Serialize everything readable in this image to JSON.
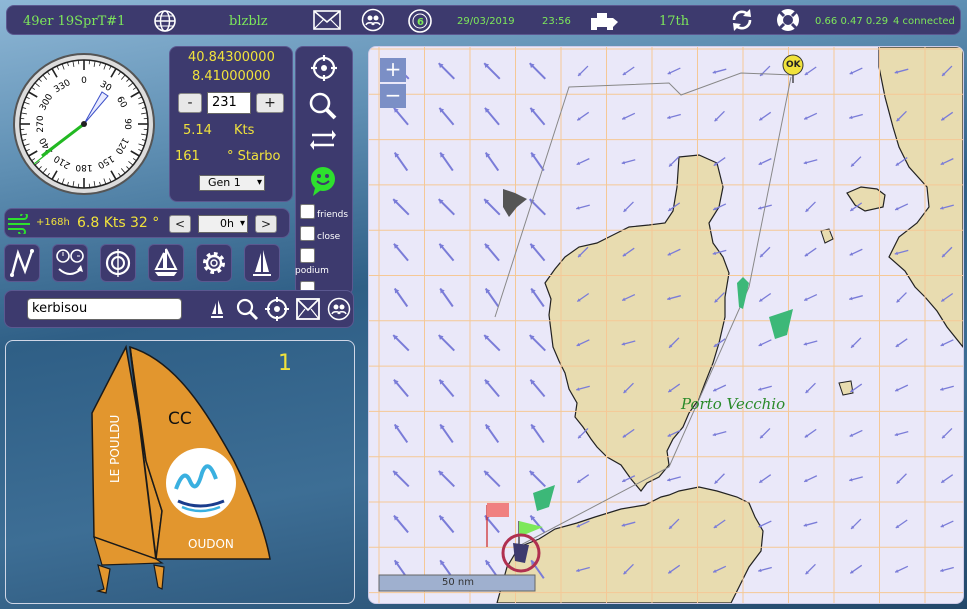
{
  "topbar": {
    "race_name": "49er 19SprT#1",
    "player_name": "blzblz",
    "notification_count": "6",
    "date": "29/03/2019",
    "time": "23:56",
    "rank": "17th",
    "load": "0.66 0.47 0.29",
    "connected": "4 connected"
  },
  "compass": {
    "ticks": [
      "0",
      "30",
      "60",
      "90",
      "120",
      "150",
      "180",
      "210",
      "240",
      "270",
      "300",
      "330"
    ]
  },
  "nav": {
    "latitude": "40.84300000",
    "longitude": "8.41000000",
    "minus_label": "-",
    "plus_label": "+",
    "heading_value": "231",
    "speed": "5.14",
    "speed_unit": "Kts",
    "twa": "161",
    "tack": "° Starbo",
    "sail_select": "Gen 1"
  },
  "wind": {
    "forecast": "+168h",
    "speed": "6.8 Kts",
    "direction": "32 °",
    "prev_label": "<",
    "next_label": ">",
    "offset_select": "0h"
  },
  "filters": {
    "friends": "friends",
    "close": "close",
    "podium": "podium"
  },
  "search": {
    "value": "kerbisou"
  },
  "boat": {
    "number": "1",
    "initials": "CC",
    "sail_text_left": "LE POULDU",
    "sail_text_bottom": "OUDON"
  },
  "map": {
    "zoom_in": "+",
    "zoom_out": "−",
    "place_label": "Porto Vecchio",
    "scale_label": "50 nm",
    "waypoint_label": "OK"
  },
  "colors": {
    "panel": "#3d3a6e",
    "green_text": "#7de85a",
    "yellow_text": "#f0e23c",
    "land": "#e8dcb0",
    "sea": "#eae8f9",
    "grid": "#f5c896",
    "arrow": "#7a7cd8",
    "sail": "#e2962e"
  }
}
